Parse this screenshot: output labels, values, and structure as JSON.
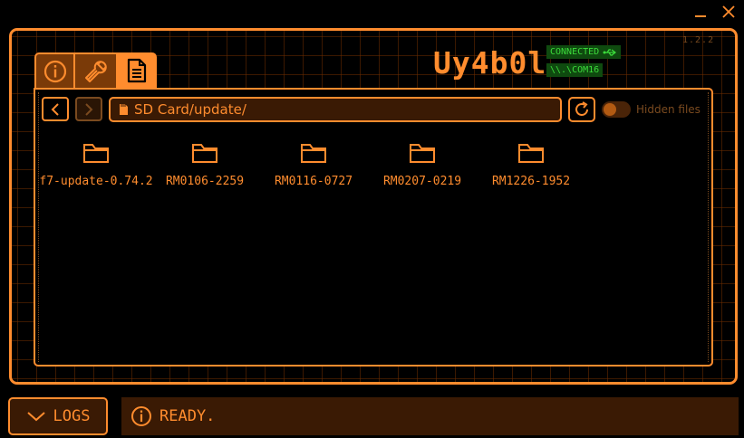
{
  "window": {
    "minimize_icon": "minimize-icon",
    "close_icon": "close-icon"
  },
  "header": {
    "version": "1.2.2",
    "logo": "Uy4b0l",
    "connection_status": "CONNECTED",
    "port": "\\\\.\\COM16"
  },
  "tabs": [
    {
      "name": "info",
      "icon": "info-icon"
    },
    {
      "name": "tools",
      "icon": "wrench-icon"
    },
    {
      "name": "files",
      "icon": "document-icon",
      "active": true
    }
  ],
  "toolbar": {
    "path": "SD Card/update/",
    "hidden_files_label": "Hidden files",
    "hidden_files_enabled": false
  },
  "files": [
    {
      "name": "f7-update-0.74.2",
      "type": "folder"
    },
    {
      "name": "RM0106-2259",
      "type": "folder"
    },
    {
      "name": "RM0116-0727",
      "type": "folder"
    },
    {
      "name": "RM0207-0219",
      "type": "folder"
    },
    {
      "name": "RM1226-1952",
      "type": "folder"
    }
  ],
  "footer": {
    "logs_label": "LOGS",
    "status_text": "READY."
  },
  "colors": {
    "accent": "#ff8c2e",
    "dim": "#7a4a1f",
    "connected": "#3bdc3b"
  }
}
